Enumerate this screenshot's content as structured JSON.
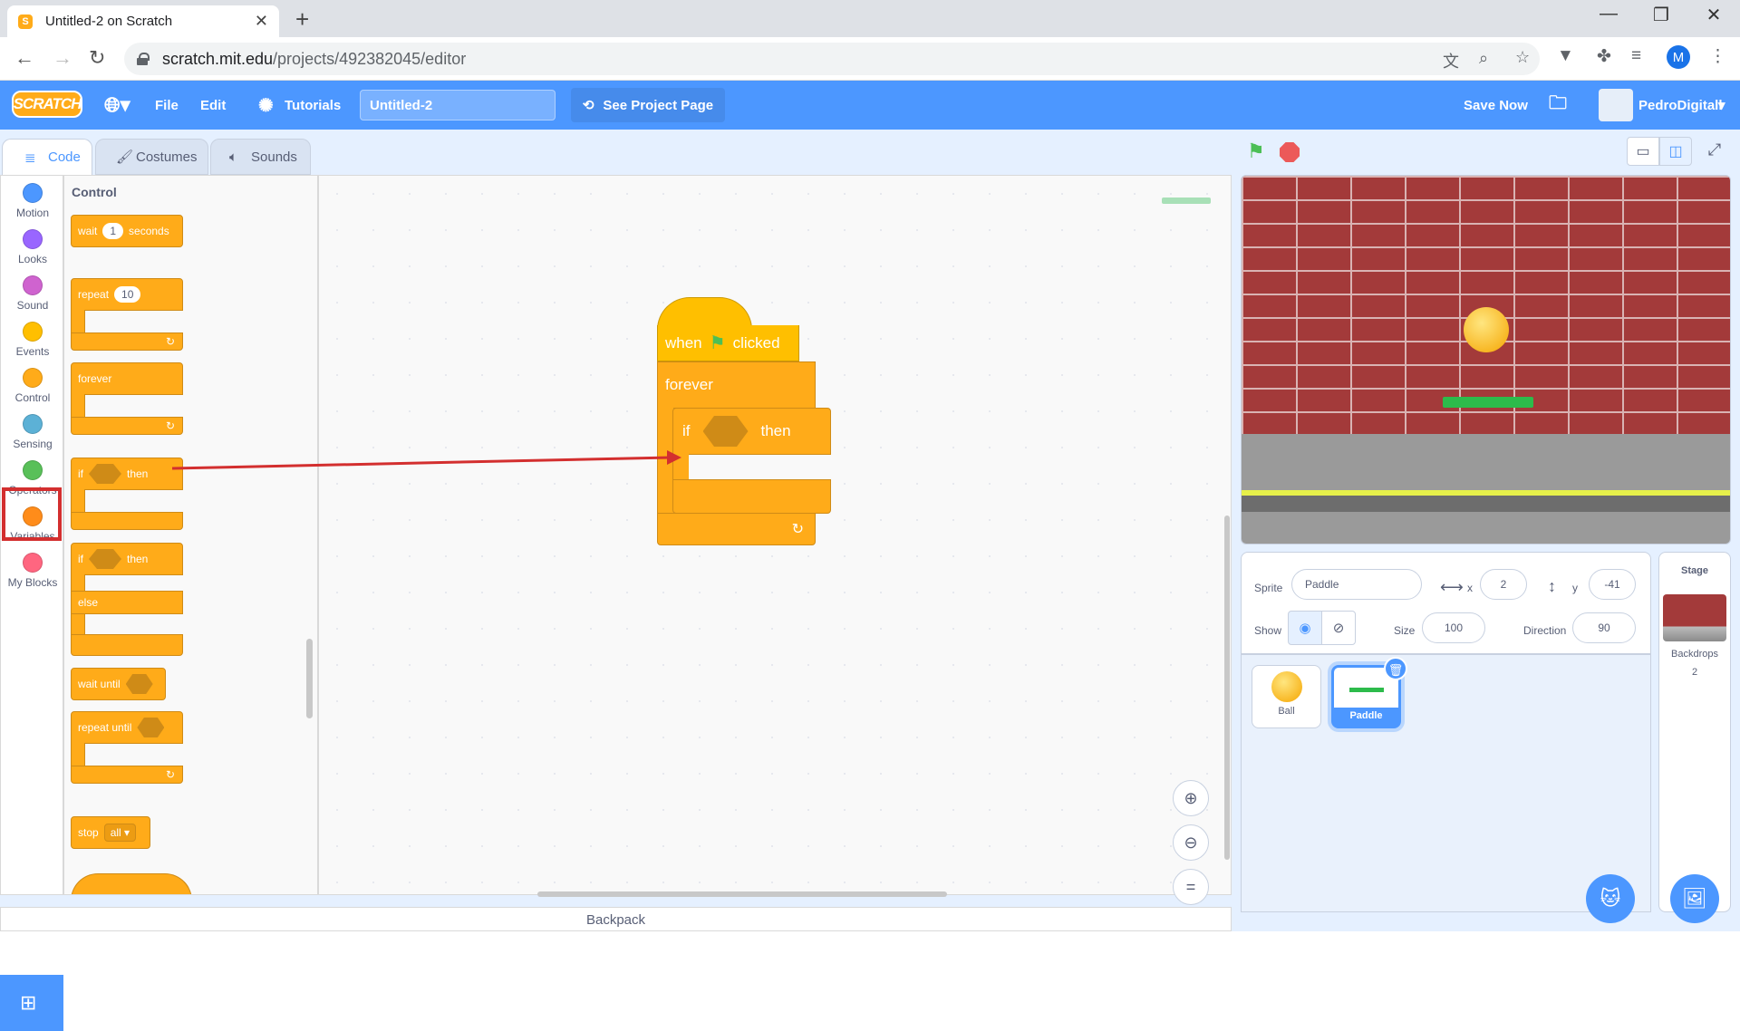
{
  "browser": {
    "tab_title": "Untitled-2 on Scratch",
    "tab_favicon": "S",
    "url_host": "scratch.mit.edu",
    "url_path": "/projects/492382045/editor",
    "profile_initial": "M"
  },
  "menubar": {
    "logo": "SCRATCH",
    "file": "File",
    "edit": "Edit",
    "tutorials": "Tutorials",
    "project_title": "Untitled-2",
    "see_project": "See Project Page",
    "save_now": "Save Now",
    "username": "PedroDigitall"
  },
  "tabs": {
    "code": "Code",
    "costumes": "Costumes",
    "sounds": "Sounds"
  },
  "categories": [
    {
      "label": "Motion",
      "color": "#4c97ff"
    },
    {
      "label": "Looks",
      "color": "#9966ff"
    },
    {
      "label": "Sound",
      "color": "#cf63cf"
    },
    {
      "label": "Events",
      "color": "#ffbf00"
    },
    {
      "label": "Control",
      "color": "#ffab19"
    },
    {
      "label": "Sensing",
      "color": "#5cb1d6"
    },
    {
      "label": "Operators",
      "color": "#59c059"
    },
    {
      "label": "Variables",
      "color": "#ff8c1a"
    },
    {
      "label": "My Blocks",
      "color": "#ff6680"
    }
  ],
  "palette": {
    "heading": "Control",
    "wait": "wait",
    "wait_value": "1",
    "seconds": "seconds",
    "repeat": "repeat",
    "repeat_value": "10",
    "forever": "forever",
    "if": "if",
    "then": "then",
    "else": "else",
    "wait_until": "wait until",
    "repeat_until": "repeat until",
    "stop": "stop",
    "stop_value": "all"
  },
  "script": {
    "when": "when",
    "clicked": "clicked",
    "forever": "forever",
    "if": "if",
    "then": "then"
  },
  "sprite_info": {
    "sprite_label": "Sprite",
    "sprite_name": "Paddle",
    "x_label": "x",
    "x": "2",
    "y_label": "y",
    "y": "-41",
    "show_label": "Show",
    "size_label": "Size",
    "size": "100",
    "direction_label": "Direction",
    "direction": "90"
  },
  "sprites": [
    {
      "name": "Ball"
    },
    {
      "name": "Paddle"
    }
  ],
  "stage_panel": {
    "title": "Stage",
    "backdrops_label": "Backdrops",
    "backdrops_count": "2"
  },
  "backpack": "Backpack"
}
